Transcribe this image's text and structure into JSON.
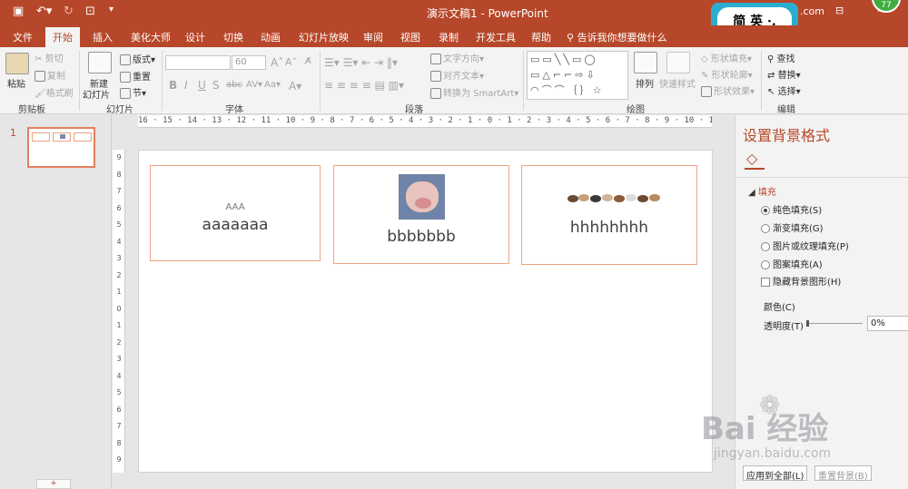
{
  "titlebar": {
    "title": "演示文稿1  -  PowerPoint",
    "com_text": ".com",
    "badge_text": "简 英 ·."
  },
  "tabs": [
    "文件",
    "开始",
    "插入",
    "美化大师",
    "设计",
    "切换",
    "动画",
    "幻灯片放映",
    "审阅",
    "视图",
    "录制",
    "开发工具",
    "帮助"
  ],
  "tell_me": "告诉我你想要做什么",
  "ribbon": {
    "clipboard": {
      "paste": "粘贴",
      "cut": "剪切",
      "copy": "复制",
      "painter": "格式刷",
      "label": "剪贴板"
    },
    "slides": {
      "new_slide_line1": "新建",
      "new_slide_line2": "幻灯片",
      "layout": "版式",
      "reset": "重置",
      "section": "节",
      "label": "幻灯片"
    },
    "font": {
      "size": "60",
      "label": "字体",
      "aa": "Aa"
    },
    "paragraph": {
      "text_direction": "文字方向",
      "align_text": "对齐文本",
      "smartart": "转换为 SmartArt",
      "label": "段落"
    },
    "drawing": {
      "arrange": "排列",
      "quick_styles": "快速样式",
      "shape_fill": "形状填充",
      "shape_outline": "形状轮廓",
      "shape_effects": "形状效果",
      "label": "绘图"
    },
    "editing": {
      "find": "查找",
      "replace": "替换",
      "select": "选择",
      "label": "编辑"
    }
  },
  "thumbnail_number": "1",
  "hruler_text": "16 · 15 · 14 · 13 · 12 · 11 · 10 · 9 · 8 · 7 · 6 · 5 · 4 · 3 · 2 · 1 · 0 · 1 · 2 · 3 · 4 · 5 · 6 · 7 · 8 · 9 · 10 · 11 · 12 · 13 · 14 · 15 · 16",
  "vruler_numbers": [
    "9",
    "8",
    "7",
    "6",
    "5",
    "4",
    "3",
    "2",
    "1",
    "0",
    "1",
    "2",
    "3",
    "4",
    "5",
    "6",
    "7",
    "8",
    "9"
  ],
  "slide": {
    "box1_small": "AAA",
    "box1_big": "aaaaaaa",
    "box2_big": "bbbbbbb",
    "box3_big": "hhhhhhhh"
  },
  "pane": {
    "title": "设置背景格式",
    "fill_header": "填充",
    "options": [
      "纯色填充(S)",
      "渐变填充(G)",
      "图片或纹理填充(P)",
      "图案填充(A)"
    ],
    "hide_graphics": "隐藏背景图形(H)",
    "color_label": "颜色(C)",
    "transparency_label": "透明度(T)",
    "transparency_value": "0%",
    "apply_all": "应用到全部(L)",
    "reset_bg": "重置背景(B)"
  },
  "add_slide": "+",
  "watermark": {
    "main": "Bai  经验",
    "url": "jingyan.baidu.com"
  },
  "avatar_text": "77"
}
